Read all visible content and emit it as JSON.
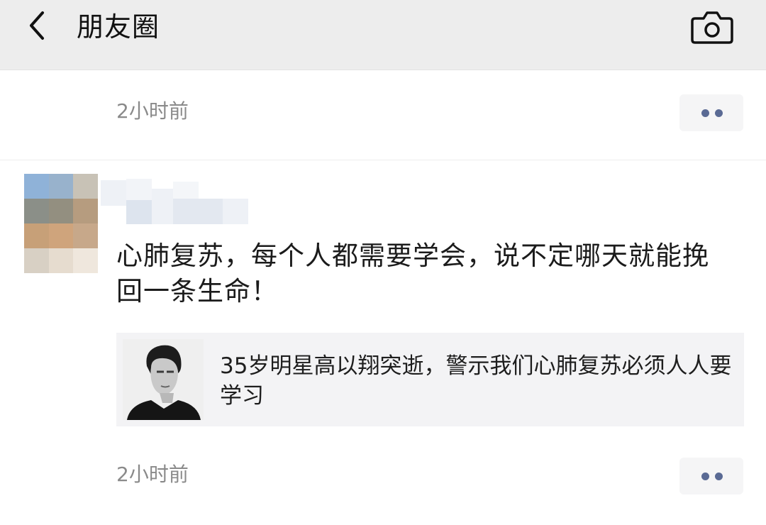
{
  "header": {
    "title": "朋友圈",
    "back_icon": "chevron-left-icon",
    "camera_icon": "camera-icon"
  },
  "posts": [
    {
      "time": "2小时前"
    },
    {
      "text": "心肺复苏，每个人都需要学会，说不定哪天就能挽回一条生命！",
      "link": {
        "title": "35岁明星高以翔突逝，警示我们心肺复苏必须人人要学习"
      },
      "time": "2小时前"
    }
  ],
  "colors": {
    "header_bg": "#ededed",
    "more_dots": "#5a6a94",
    "time_text": "#8a8a8a",
    "link_bg": "#f3f3f5"
  }
}
